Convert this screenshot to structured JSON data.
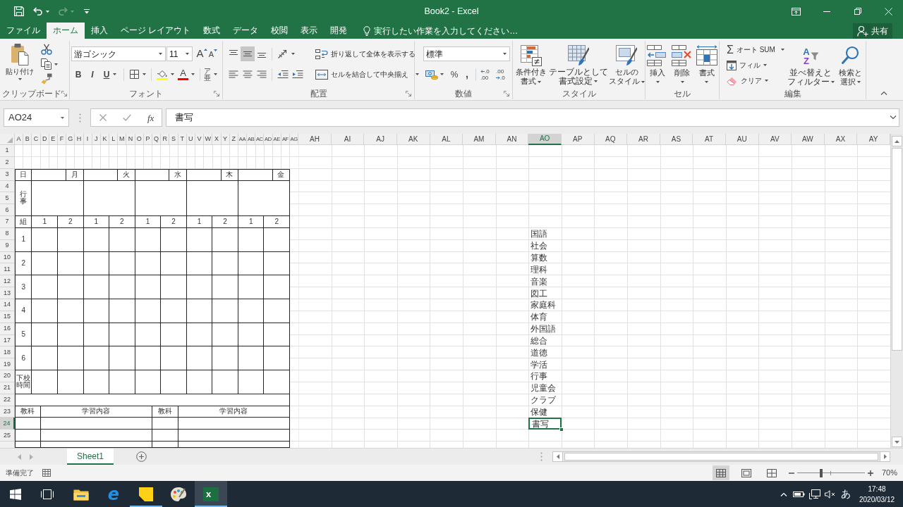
{
  "title_bar": {
    "title": "Book2 - Excel"
  },
  "ribbon_tabs": [
    {
      "label": "ファイル",
      "selected": false
    },
    {
      "label": "ホーム",
      "selected": true
    },
    {
      "label": "挿入",
      "selected": false
    },
    {
      "label": "ページ レイアウト",
      "selected": false
    },
    {
      "label": "数式",
      "selected": false
    },
    {
      "label": "データ",
      "selected": false
    },
    {
      "label": "校閲",
      "selected": false
    },
    {
      "label": "表示",
      "selected": false
    },
    {
      "label": "開発",
      "selected": false
    }
  ],
  "tell_me": {
    "placeholder": "実行したい作業を入力してください…"
  },
  "share_button": "共有",
  "ribbon": {
    "clipboard": {
      "paste": "貼り付け",
      "label": "クリップボード"
    },
    "font": {
      "font_name": "游ゴシック",
      "font_size": "11",
      "grow_font": "A",
      "shrink_font": "A",
      "bold": "B",
      "italic": "I",
      "underline": "U",
      "font_color": "A",
      "phonetic": "ア亜",
      "label": "フォント"
    },
    "alignment": {
      "vertical_align": [
        {
          "selected": false
        },
        {
          "selected": true
        },
        {
          "selected": false
        }
      ],
      "wrap_text": "折り返して全体を表示する",
      "merge_center": "セルを結合して中央揃え",
      "label": "配置"
    },
    "number": {
      "format": "標準",
      "percent": "%",
      "comma": ",",
      "increase_decimal": [
        ".0",
        ".00"
      ],
      "decrease_decimal": [
        ".00",
        ".0"
      ],
      "label": "数値"
    },
    "styles": {
      "buttons": [
        [
          "条件付き",
          "書式"
        ],
        [
          "テーブルとして",
          "書式設定"
        ],
        [
          "セルの",
          "スタイル"
        ]
      ],
      "label": "スタイル"
    },
    "cells": {
      "buttons": [
        "挿入",
        "削除",
        "書式"
      ],
      "label": "セル"
    },
    "editing": {
      "autosum_symbol": "Σ",
      "autosum": "オート SUM",
      "fill": "フィル",
      "clear": "クリア",
      "sort_letters": [
        "A",
        "Z"
      ],
      "sort_filter": [
        "並べ替えと",
        "フィルター"
      ],
      "find_select": [
        "検索と",
        "選択"
      ],
      "label": "編集"
    }
  },
  "formula_bar": {
    "name_box": "AO24",
    "fx": "fx",
    "value": "書写"
  },
  "sheet": {
    "columns": [
      {
        "label": "A",
        "selected": false
      },
      {
        "label": "B",
        "selected": false
      },
      {
        "label": "C",
        "selected": false
      },
      {
        "label": "D",
        "selected": false
      },
      {
        "label": "E",
        "selected": false
      },
      {
        "label": "F",
        "selected": false
      },
      {
        "label": "G",
        "selected": false
      },
      {
        "label": "H",
        "selected": false
      },
      {
        "label": "I",
        "selected": false
      },
      {
        "label": "J",
        "selected": false
      },
      {
        "label": "K",
        "selected": false
      },
      {
        "label": "L",
        "selected": false
      },
      {
        "label": "M",
        "selected": false
      },
      {
        "label": "N",
        "selected": false
      },
      {
        "label": "O",
        "selected": false
      },
      {
        "label": "P",
        "selected": false
      },
      {
        "label": "Q",
        "selected": false
      },
      {
        "label": "R",
        "selected": false
      },
      {
        "label": "S",
        "selected": false
      },
      {
        "label": "T",
        "selected": false
      },
      {
        "label": "U",
        "selected": false
      },
      {
        "label": "V",
        "selected": false
      },
      {
        "label": "W",
        "selected": false
      },
      {
        "label": "X",
        "selected": false
      },
      {
        "label": "Y",
        "selected": false
      },
      {
        "label": "Z",
        "selected": false
      },
      {
        "label": "AA",
        "selected": false
      },
      {
        "label": "AB",
        "selected": false
      },
      {
        "label": "AC",
        "selected": false
      },
      {
        "label": "AD",
        "selected": false
      },
      {
        "label": "AE",
        "selected": false
      },
      {
        "label": "AF",
        "selected": false
      },
      {
        "label": "AG",
        "selected": false
      },
      {
        "label": "AH",
        "selected": false
      },
      {
        "label": "AI",
        "selected": false
      },
      {
        "label": "AJ",
        "selected": false
      },
      {
        "label": "AK",
        "selected": false
      },
      {
        "label": "AL",
        "selected": false
      },
      {
        "label": "AM",
        "selected": false
      },
      {
        "label": "AN",
        "selected": false
      },
      {
        "label": "AO",
        "selected": true
      },
      {
        "label": "AP",
        "selected": false
      },
      {
        "label": "AQ",
        "selected": false
      },
      {
        "label": "AR",
        "selected": false
      },
      {
        "label": "AS",
        "selected": false
      },
      {
        "label": "AT",
        "selected": false
      },
      {
        "label": "AU",
        "selected": false
      },
      {
        "label": "AV",
        "selected": false
      },
      {
        "label": "AW",
        "selected": false
      },
      {
        "label": "AX",
        "selected": false
      },
      {
        "label": "AY",
        "selected": false
      }
    ],
    "rows": [
      {
        "label": "1",
        "selected": false
      },
      {
        "label": "2",
        "selected": false
      },
      {
        "label": "3",
        "selected": false
      },
      {
        "label": "4",
        "selected": false
      },
      {
        "label": "5",
        "selected": false
      },
      {
        "label": "6",
        "selected": false
      },
      {
        "label": "7",
        "selected": false
      },
      {
        "label": "8",
        "selected": false
      },
      {
        "label": "9",
        "selected": false
      },
      {
        "label": "10",
        "selected": false
      },
      {
        "label": "11",
        "selected": false
      },
      {
        "label": "12",
        "selected": false
      },
      {
        "label": "13",
        "selected": false
      },
      {
        "label": "14",
        "selected": false
      },
      {
        "label": "15",
        "selected": false
      },
      {
        "label": "16",
        "selected": false
      },
      {
        "label": "17",
        "selected": false
      },
      {
        "label": "18",
        "selected": false
      },
      {
        "label": "19",
        "selected": false
      },
      {
        "label": "20",
        "selected": false
      },
      {
        "label": "21",
        "selected": false
      },
      {
        "label": "22",
        "selected": false
      },
      {
        "label": "23",
        "selected": false
      },
      {
        "label": "24",
        "selected": true
      },
      {
        "label": "25",
        "selected": false
      }
    ],
    "timetable": {
      "date_label": "日",
      "days": [
        "月",
        "火",
        "水",
        "木",
        "金"
      ],
      "events_label": "行事",
      "class_label": "組",
      "classes": [
        "1",
        "2",
        "1",
        "2",
        "1",
        "2",
        "1",
        "2",
        "1",
        "2"
      ],
      "periods": [
        "1",
        "2",
        "3",
        "4",
        "5",
        "6"
      ],
      "dismissal_label": "下校時間",
      "notes_headers": [
        "教科",
        "学習内容",
        "教科",
        "学習内容"
      ]
    },
    "subjects": [
      {
        "text": "国語",
        "selected": false
      },
      {
        "text": "社会",
        "selected": false
      },
      {
        "text": "算数",
        "selected": false
      },
      {
        "text": "理科",
        "selected": false
      },
      {
        "text": "音楽",
        "selected": false
      },
      {
        "text": "図工",
        "selected": false
      },
      {
        "text": "家庭科",
        "selected": false
      },
      {
        "text": "体育",
        "selected": false
      },
      {
        "text": "外国語",
        "selected": false
      },
      {
        "text": "総合",
        "selected": false
      },
      {
        "text": "道徳",
        "selected": false
      },
      {
        "text": "学活",
        "selected": false
      },
      {
        "text": "行事",
        "selected": false
      },
      {
        "text": "児童会",
        "selected": false
      },
      {
        "text": "クラブ",
        "selected": false
      },
      {
        "text": "保健",
        "selected": false
      },
      {
        "text": "書写",
        "selected": true
      }
    ]
  },
  "sheet_tabs": [
    {
      "label": "Sheet1",
      "selected": true
    }
  ],
  "status_bar": {
    "status": "準備完了",
    "views": [
      {
        "selected": true
      },
      {
        "selected": false
      },
      {
        "selected": false
      }
    ],
    "zoom": {
      "level": 0.35,
      "reading": "70%"
    }
  },
  "taskbar": {
    "apps": [
      {
        "running": false,
        "active": false
      },
      {
        "logo_text": "e",
        "running": false,
        "active": false
      },
      {
        "running": true,
        "active": false
      },
      {
        "running": false,
        "active": false
      },
      {
        "logo_text": "x",
        "running": true,
        "active": true
      }
    ],
    "ime": "あ",
    "time": "17:48",
    "date": "2020/03/12"
  }
}
